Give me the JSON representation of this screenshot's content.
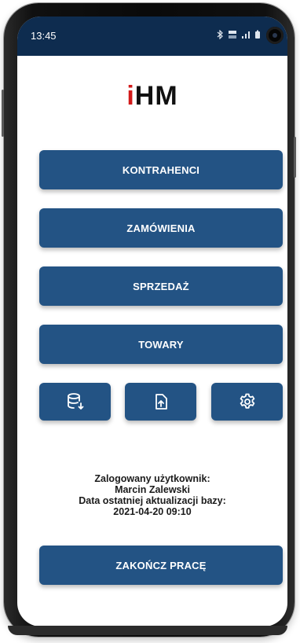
{
  "status_bar": {
    "time": "13:45",
    "icons": [
      "bluetooth-icon",
      "lte-icon",
      "signal-icon",
      "battery-icon"
    ]
  },
  "logo": {
    "prefix": "i",
    "text": "HM"
  },
  "menu": {
    "kontrahenci": "KONTRAHENCI",
    "zamowienia": "ZAMÓWIENIA",
    "sprzedaz": "SPRZEDAŻ",
    "towary": "TOWARY"
  },
  "tool_buttons": [
    "database-download-icon",
    "file-upload-icon",
    "settings-gear-icon"
  ],
  "user_info": {
    "logged_label": "Zalogowany użytkownik:",
    "user_name": "Marcin Zalewski",
    "update_label": "Data ostatniej aktualizacji bazy:",
    "update_date": "2021-04-20 09:10"
  },
  "exit_button": "ZAKOŃCZ PRACĘ",
  "colors": {
    "button": "#235384",
    "status_bar": "#0e2c4f",
    "logo_accent": "#d21a1a"
  }
}
